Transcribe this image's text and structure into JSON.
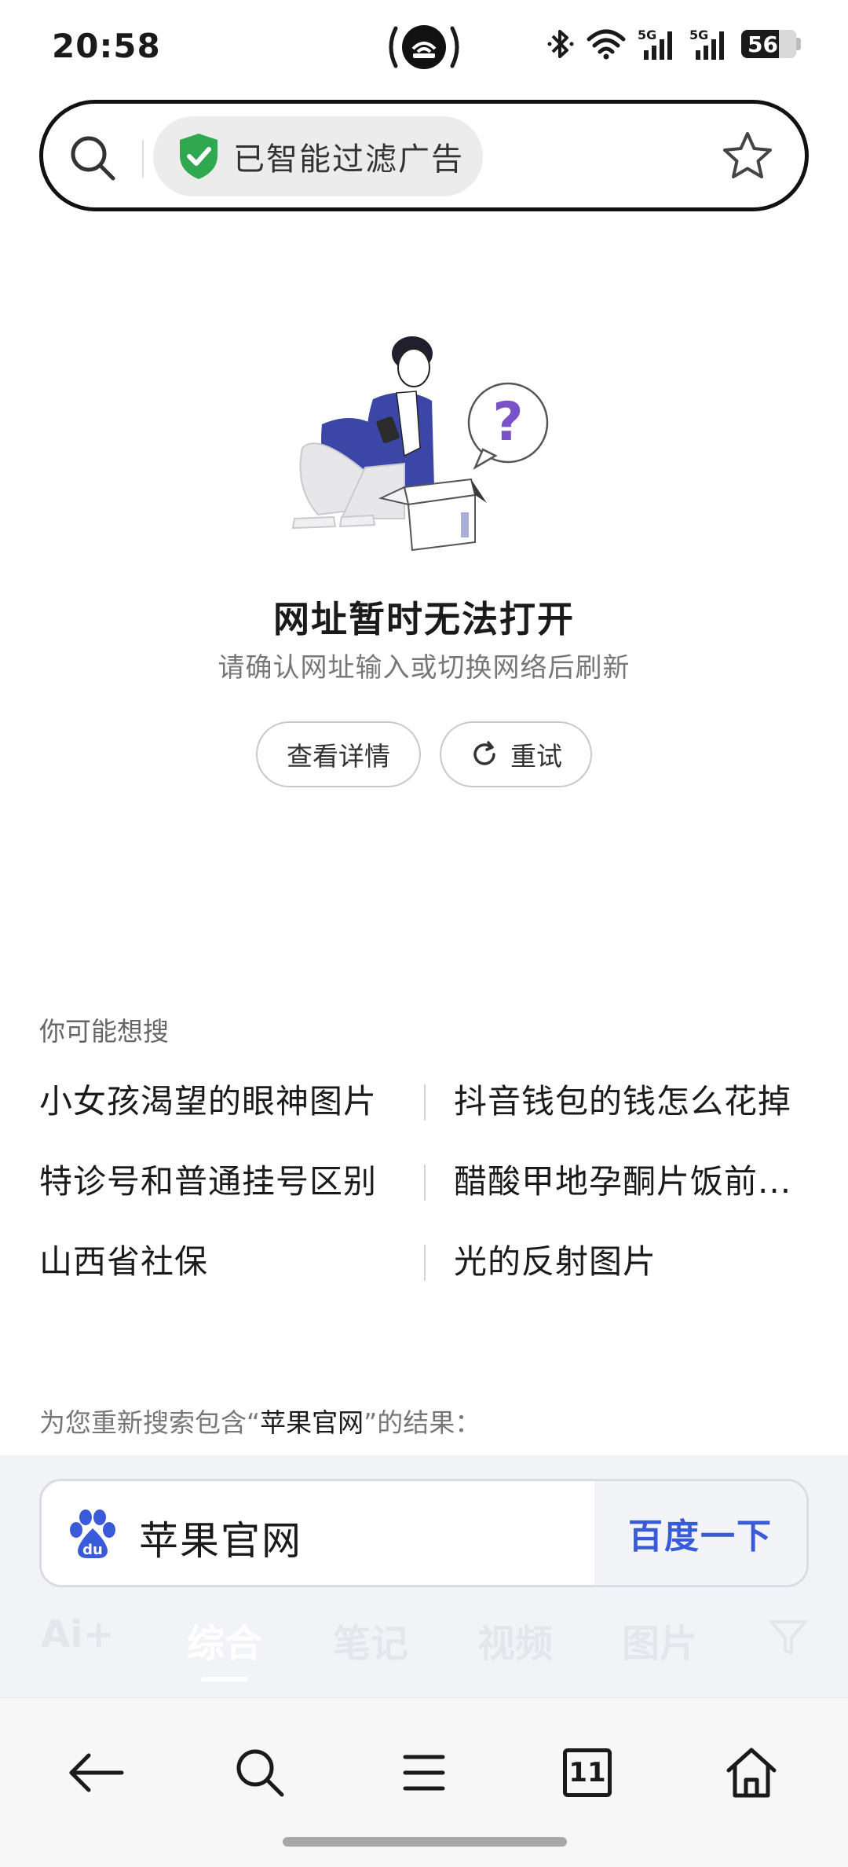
{
  "status_bar": {
    "time": "20:58",
    "battery": "56",
    "network_1": "5G",
    "network_2": "5G"
  },
  "address_bar": {
    "adfilter_label": "已智能过滤广告",
    "icons": [
      "search-icon",
      "shield-check-icon",
      "star-icon"
    ]
  },
  "error": {
    "title": "网址暂时无法打开",
    "subtitle": "请确认网址输入或切换网络后刷新",
    "details_button": "查看详情",
    "retry_button": "重试"
  },
  "suggestions": {
    "title": "你可能想搜",
    "items": [
      "小女孩渴望的眼神图片",
      "抖音钱包的钱怎么花掉",
      "特诊号和普通挂号区别",
      "醋酸甲地孕酮片饭前...",
      "山西省社保",
      "光的反射图片"
    ]
  },
  "research": {
    "prefix": "为您重新搜索包含“",
    "keyword": "苹果官网",
    "suffix": "”的结果："
  },
  "baidu": {
    "query": "苹果官网",
    "button": "百度一下",
    "tabs": [
      "Ai+",
      "综合",
      "笔记",
      "视频",
      "图片"
    ],
    "active_tab": "综合"
  },
  "bottom_nav": {
    "tabs_count": "11",
    "icons": [
      "back-arrow-icon",
      "search-icon",
      "menu-icon",
      "tabs-icon",
      "home-icon"
    ]
  },
  "colors": {
    "accent_blue": "#3a5bd9",
    "shield_green": "#2fa84f",
    "question_purple": "#7a52c7"
  }
}
